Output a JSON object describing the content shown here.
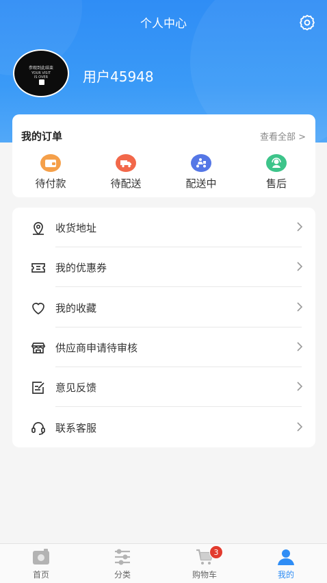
{
  "header": {
    "title": "个人中心",
    "username": "用户45948",
    "avatar_text": [
      "参观到此结束",
      "YOUR VISIT",
      "IS OVER"
    ]
  },
  "orders": {
    "title": "我的订单",
    "view_all": "查看全部 >",
    "items": [
      {
        "label": "待付款",
        "icon": "wallet-icon",
        "color": "#f5a04a"
      },
      {
        "label": "待配送",
        "icon": "truck-icon",
        "color": "#f2684a"
      },
      {
        "label": "配送中",
        "icon": "delivery-scooter-icon",
        "color": "#5577e6"
      },
      {
        "label": "售后",
        "icon": "customer-service-icon",
        "color": "#3dc48a"
      }
    ]
  },
  "menu": {
    "items": [
      {
        "label": "收货地址",
        "icon": "location-pin-icon"
      },
      {
        "label": "我的优惠券",
        "icon": "coupon-icon"
      },
      {
        "label": "我的收藏",
        "icon": "heart-icon"
      },
      {
        "label": "供应商申请待审核",
        "icon": "store-icon"
      },
      {
        "label": "意见反馈",
        "icon": "feedback-icon"
      },
      {
        "label": "联系客服",
        "icon": "headset-icon"
      }
    ]
  },
  "tabbar": {
    "items": [
      {
        "label": "首页",
        "icon": "home-icon",
        "active": false
      },
      {
        "label": "分类",
        "icon": "category-icon",
        "active": false
      },
      {
        "label": "购物车",
        "icon": "cart-icon",
        "active": false,
        "badge": "3"
      },
      {
        "label": "我的",
        "icon": "profile-icon",
        "active": true
      }
    ]
  },
  "colors": {
    "accent": "#2f8df5",
    "badge": "#e23b2e"
  }
}
